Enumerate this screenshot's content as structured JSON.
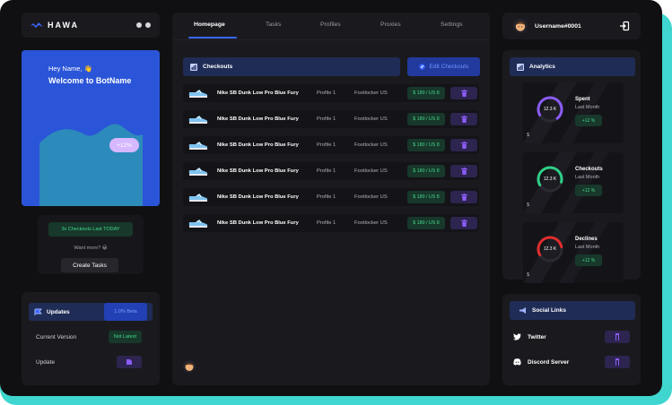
{
  "app": {
    "logo_text": "HAWA"
  },
  "hero": {
    "greeting": "Hey Name, 👋",
    "title": "Welcome to BotName",
    "badge": "+12%"
  },
  "promo": {
    "badge": "3x Checkouts Last TODAY",
    "want_more": "Want more? 😀",
    "button": "Create Tasks"
  },
  "updates": {
    "title": "Updates",
    "beta_label": "1.0% Beta",
    "rows": [
      {
        "label": "Current Version",
        "status": "Not Latest"
      },
      {
        "label": "Update"
      }
    ]
  },
  "nav": {
    "tabs": [
      {
        "label": "Homepage",
        "active": true
      },
      {
        "label": "Tasks"
      },
      {
        "label": "Profiles"
      },
      {
        "label": "Proxies"
      },
      {
        "label": "Settings"
      }
    ]
  },
  "checkouts": {
    "title": "Checkouts",
    "edit_label": "Edit Checkouts",
    "rows": [
      {
        "name": "Nike SB Dunk Low Pro Blue Fury",
        "profile": "Profile 1",
        "store": "Footlocker US",
        "price": "$ 180 / US 8"
      },
      {
        "name": "Nike SB Dunk Low Pro Blue Fury",
        "profile": "Profile 1",
        "store": "Footlocker US",
        "price": "$ 180 / US 8"
      },
      {
        "name": "Nike SB Dunk Low Pro Blue Fury",
        "profile": "Profile 1",
        "store": "Footlocker US",
        "price": "$ 180 / US 8"
      },
      {
        "name": "Nike SB Dunk Low Pro Blue Fury",
        "profile": "Profile 1",
        "store": "Footlocker US",
        "price": "$ 180 / US 8"
      },
      {
        "name": "Nike SB Dunk Low Pro Blue Fury",
        "profile": "Profile 1",
        "store": "Footlocker US",
        "price": "$ 180 / US 8"
      },
      {
        "name": "Nike SB Dunk Low Pro Blue Fury",
        "profile": "Profile 1",
        "store": "Footlocker US",
        "price": "$ 180 / US 8"
      }
    ]
  },
  "user": {
    "name": "Username#0001"
  },
  "analytics": {
    "title": "Analytics",
    "stats": [
      {
        "value": "12.3 K",
        "title": "Spent",
        "sub": "Last Month",
        "change": "+12 %",
        "currency": "$",
        "color": "#8b5cf6"
      },
      {
        "value": "12.3 K",
        "title": "Checkouts",
        "sub": "Last Month",
        "change": "+12 %",
        "currency": "$",
        "color": "#2fcf86"
      },
      {
        "value": "12.3 K",
        "title": "Declines",
        "sub": "Last Month",
        "change": "+12 %",
        "currency": "$",
        "color": "#e02d2d"
      }
    ]
  },
  "social": {
    "title": "Social Links",
    "links": [
      {
        "label": "Twitter"
      },
      {
        "label": "Discord Server"
      }
    ]
  }
}
